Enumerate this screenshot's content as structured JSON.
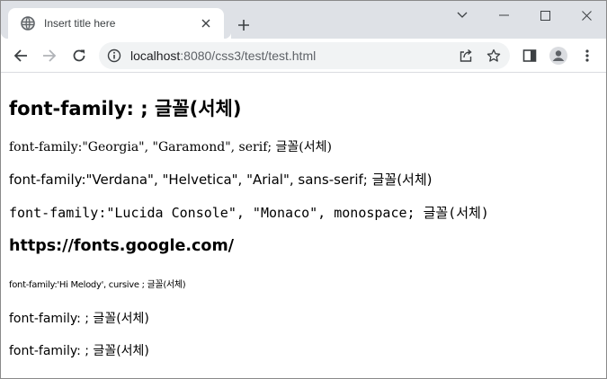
{
  "browser": {
    "tab": {
      "title": "Insert title here",
      "favicon": "globe-icon"
    },
    "new_tab_icon": "plus-icon",
    "window_controls": [
      "chevron-down-icon",
      "minimize-icon",
      "maximize-icon",
      "close-icon"
    ],
    "address": {
      "host": "localhost",
      "path": ":8080/css3/test/test.html"
    },
    "toolbar_icons": [
      "back-arrow-icon",
      "forward-arrow-icon",
      "reload-icon",
      "info-icon",
      "share-icon",
      "star-icon",
      "side-panel-icon",
      "profile-icon",
      "menu-icon"
    ]
  },
  "page": {
    "heading": "font-family: ; 글꼴(서체)",
    "lines": {
      "georgia": "font-family:\"Georgia\", \"Garamond\", serif; 글꼴(서체)",
      "verdana": "font-family:\"Verdana\", \"Helvetica\", \"Arial\", sans-serif; 글꼴(서체)",
      "lucida": "font-family:\"Lucida Console\", \"Monaco\", monospace; 글꼴(서체)",
      "hi_melody": "font-family:'Hi Melody', cursive ; 글꼴(서체)",
      "plain1": "font-family: ; 글꼴(서체)",
      "plain2": "font-family: ; 글꼴(서체)"
    },
    "link_heading": "https://fonts.google.com/"
  }
}
